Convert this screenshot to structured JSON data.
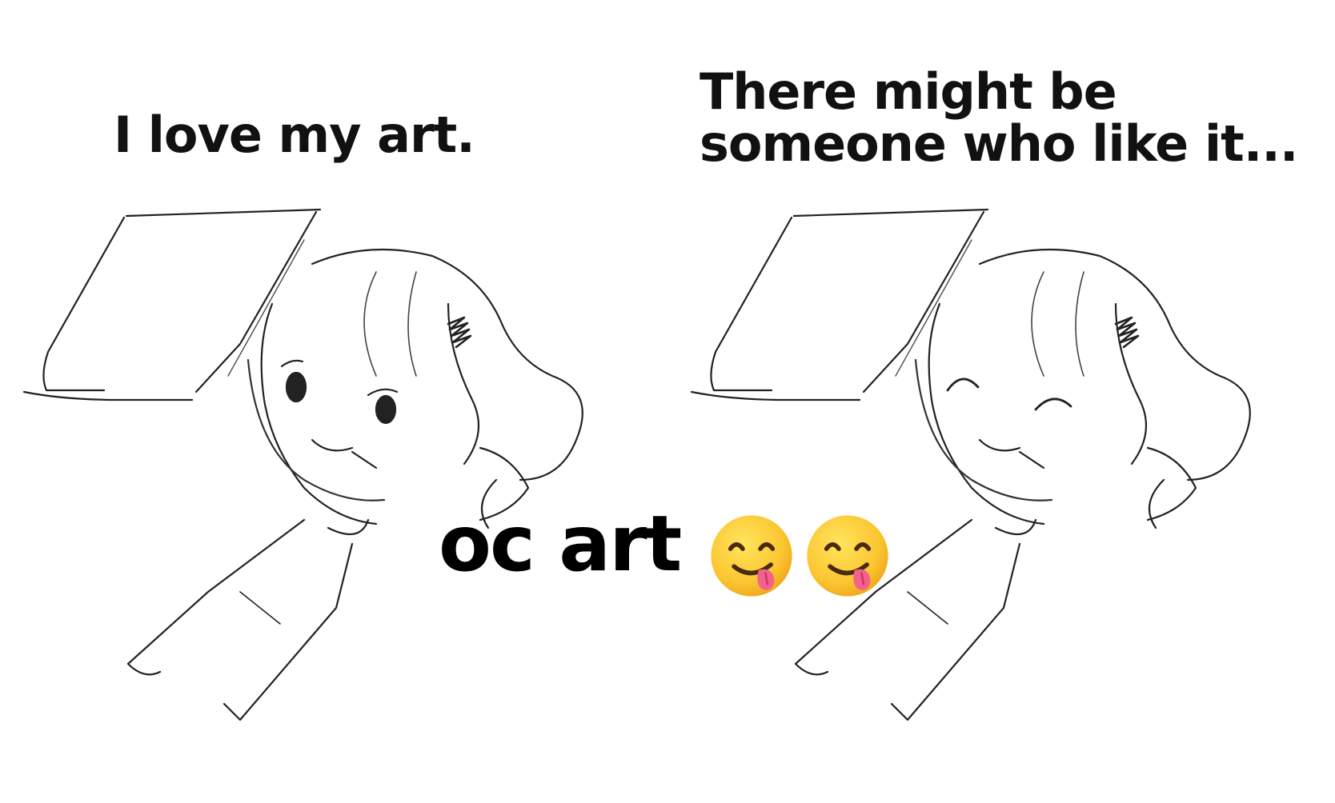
{
  "left_panel": {
    "caption": "I love my art."
  },
  "right_panel": {
    "caption_line1": "There might be",
    "caption_line2": "someone who like it..."
  },
  "overlay": {
    "text": "oc art",
    "emojis": [
      "savoring-food-face-icon",
      "savoring-food-face-icon"
    ]
  }
}
